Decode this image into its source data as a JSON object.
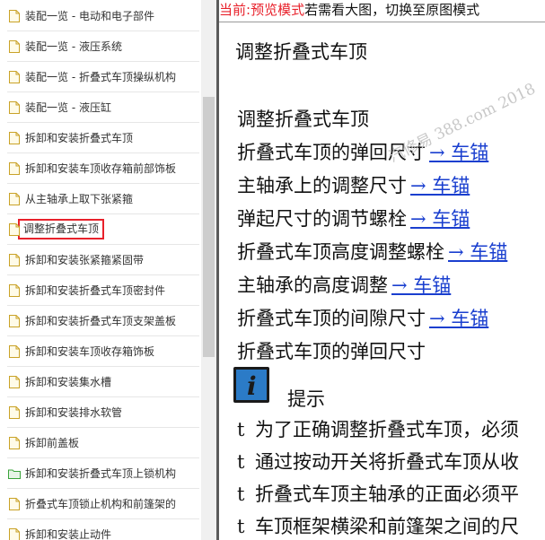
{
  "sidebar": {
    "items": [
      {
        "label": "装配一览 - 电动和电子部件",
        "icon": "document-icon"
      },
      {
        "label": "装配一览 - 液压系统",
        "icon": "document-icon"
      },
      {
        "label": "装配一览 - 折叠式车顶操纵机构",
        "icon": "document-icon"
      },
      {
        "label": "装配一览 - 液压缸",
        "icon": "document-icon"
      },
      {
        "label": "拆卸和安装折叠式车顶",
        "icon": "document-icon"
      },
      {
        "label": "拆卸和安装车顶收存箱前部饰板",
        "icon": "document-icon"
      },
      {
        "label": "从主轴承上取下张紧箍",
        "icon": "document-icon"
      },
      {
        "label": "调整折叠式车顶",
        "icon": "document-icon",
        "active": true
      },
      {
        "label": "拆卸和安装张紧箍紧固带",
        "icon": "document-icon"
      },
      {
        "label": "拆卸和安装折叠式车顶密封件",
        "icon": "document-icon"
      },
      {
        "label": "拆卸和安装折叠式车顶支架盖板",
        "icon": "document-icon"
      },
      {
        "label": "拆卸和安装车顶收存箱饰板",
        "icon": "document-icon"
      },
      {
        "label": "拆卸和安装集水槽",
        "icon": "document-icon"
      },
      {
        "label": "拆卸和安装排水软管",
        "icon": "document-icon"
      },
      {
        "label": "拆卸前盖板",
        "icon": "document-icon"
      },
      {
        "label": "拆卸和安装折叠式车顶上锁机构",
        "icon": "folder-icon"
      },
      {
        "label": "折叠式车顶锁止机构和前篷架的",
        "icon": "document-icon"
      },
      {
        "label": "拆卸和安装止动件",
        "icon": "document-icon"
      }
    ]
  },
  "mode_bar": {
    "prefix": "当前:",
    "mode": "预览模式",
    "rest": "若需看大图，切换至原图模式"
  },
  "document": {
    "title": "调整折叠式车顶",
    "lines": [
      {
        "text": "调整折叠式车顶",
        "link": ""
      },
      {
        "text": "折叠式车顶的弹回尺寸",
        "link": "→ 车锚"
      },
      {
        "text": "主轴承上的调整尺寸",
        "link": "→ 车锚"
      },
      {
        "text": "弹起尺寸的调节螺栓",
        "link": "→ 车锚"
      },
      {
        "text": "折叠式车顶高度调整螺栓",
        "link": "→ 车锚"
      },
      {
        "text": "主轴承的高度调整",
        "link": "→ 车锚"
      },
      {
        "text": "折叠式车顶的间隙尺寸",
        "link": "→ 车锚"
      },
      {
        "text": "折叠式车顶的弹回尺寸",
        "link": ""
      }
    ],
    "tip_label": "提示",
    "tips": [
      {
        "bullet": "t",
        "text": "为了正确调整折叠式车顶，必须"
      },
      {
        "bullet": "t",
        "text": "通过按动开关将折叠式车顶从收"
      },
      {
        "bullet": "t",
        "text": "折叠式车顶主轴承的正面必须平"
      },
      {
        "bullet": "t",
        "text": "车顶框架横梁和前篷架之间的尺"
      }
    ],
    "watermark": "汽修易 388.com 2018"
  },
  "colors": {
    "accent_red": "#e8212b",
    "link_blue": "#1a3fcf",
    "doc_icon_border": "#c9a227",
    "folder_icon": "#3aa33a"
  }
}
